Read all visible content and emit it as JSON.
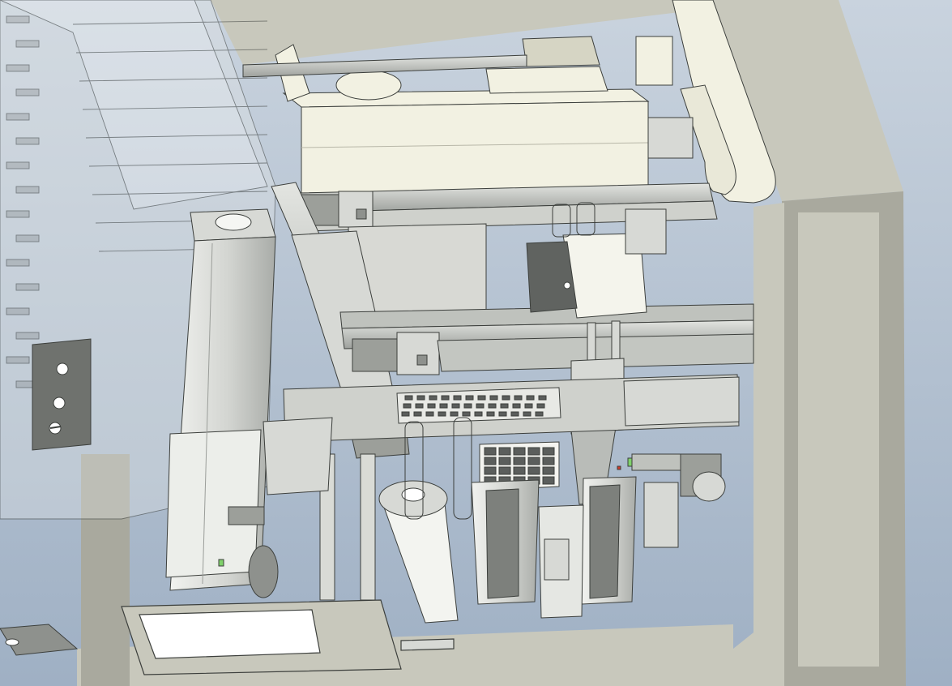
{
  "view": {
    "kind": "3d-cad-assembly-render",
    "style": "shaded-with-edges",
    "text_labels": []
  },
  "colors": {
    "background_top": "#c9d3de",
    "background_bottom": "#9fb0c4",
    "frame": "#c8c8bc",
    "frame_shadow": "#a9a99e",
    "cover_panel": "#f2f1e2",
    "cover_edge": "#d6d5c4",
    "metal": "#d7d9d5",
    "metal_dark": "#8e918d",
    "rail": "#bfc2bd",
    "motor": "#9c9f9a",
    "glass": "#e4e7e6",
    "edge": "#3c3f3c",
    "tray_cell": "#5b5e5c",
    "accent_green": "#7fd16a",
    "accent_red": "#d23a2a",
    "window_white": "#ffffff"
  }
}
